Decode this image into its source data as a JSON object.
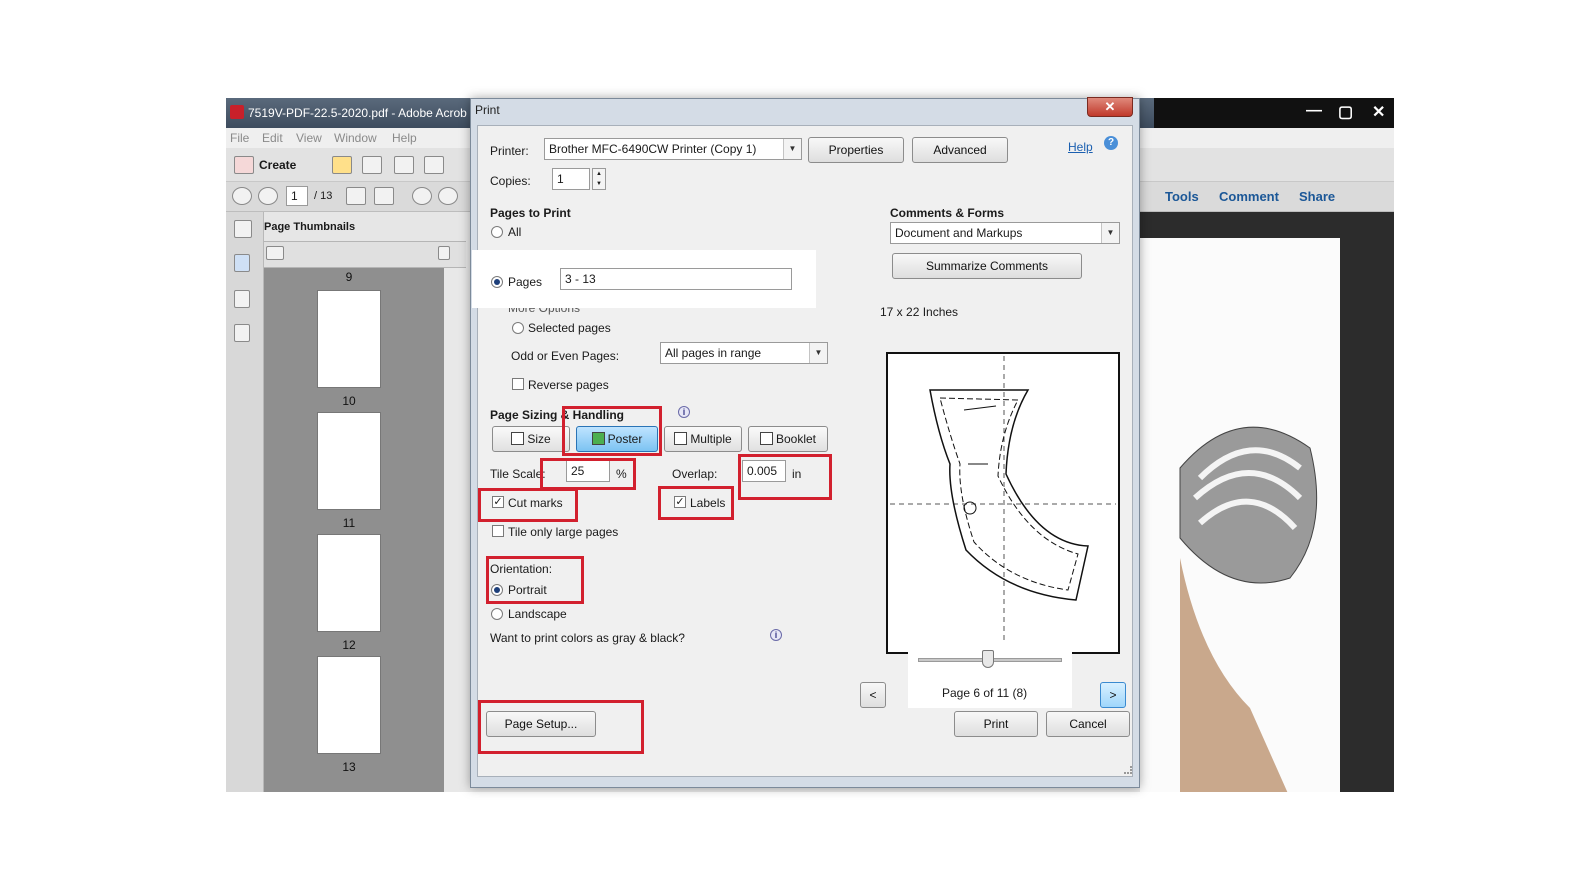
{
  "acrobat": {
    "title": "7519V-PDF-22.5-2020.pdf - Adobe Acrob",
    "menu": [
      "File",
      "Edit",
      "View",
      "Window",
      "Help"
    ],
    "create_label": "Create",
    "page_current": "1",
    "page_total": "/ 13",
    "right_tabs": [
      "Tools",
      "Comment",
      "Share"
    ],
    "panel_title": "Page Thumbnails",
    "thumbnails": [
      "9",
      "10",
      "11",
      "12",
      "13"
    ]
  },
  "dialog": {
    "title": "Print",
    "printer_label": "Printer:",
    "printer_value": "Brother MFC-6490CW Printer (Copy 1)",
    "properties_button": "Properties",
    "advanced_button": "Advanced",
    "help_link": "Help",
    "copies_label": "Copies:",
    "copies_value": "1",
    "pages_to_print": {
      "heading": "Pages to Print",
      "all_label": "All",
      "pages_label": "Pages",
      "pages_value": "3 - 13",
      "more_options": "More Options",
      "selected_pages": "Selected pages",
      "odd_even_label": "Odd or Even Pages:",
      "odd_even_value": "All pages in range",
      "reverse_pages": "Reverse pages"
    },
    "sizing": {
      "heading": "Page Sizing & Handling",
      "buttons": [
        "Size",
        "Poster",
        "Multiple",
        "Booklet"
      ],
      "active": "Poster",
      "tile_scale_label": "Tile Scale:",
      "tile_scale_value": "25",
      "tile_scale_unit": "%",
      "overlap_label": "Overlap:",
      "overlap_value": "0.005",
      "overlap_unit": "in",
      "cut_marks": "Cut marks",
      "labels": "Labels",
      "tile_large": "Tile only large pages"
    },
    "orientation": {
      "heading": "Orientation:",
      "portrait": "Portrait",
      "landscape": "Landscape"
    },
    "gray_question": "Want to print colors as gray & black?",
    "comments_forms": {
      "heading": "Comments & Forms",
      "value": "Document and Markups",
      "summarize_button": "Summarize Comments"
    },
    "preview_size": "17 x 22 Inches",
    "page_indicator": "Page 6 of 11 (8)",
    "prev_button": "<",
    "next_button": ">",
    "page_setup_button": "Page Setup...",
    "print_button": "Print",
    "cancel_button": "Cancel"
  },
  "colors": {
    "highlight_red": "#d2202e",
    "active_blue": "#7cc3f2",
    "title_bar": "#3d4c5e"
  }
}
